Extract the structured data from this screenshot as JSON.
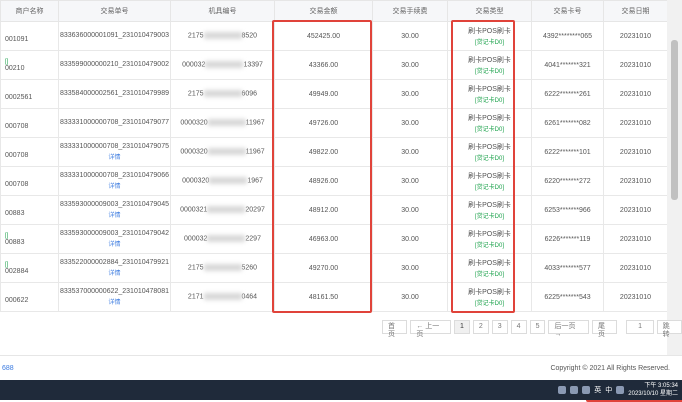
{
  "table": {
    "headers": [
      "商户名称",
      "交易单号",
      "机具编号",
      "交易金额",
      "交易手续费",
      "交易类型",
      "交易卡号",
      "交易日期"
    ],
    "rows": [
      {
        "merchant": "",
        "merchant_code": "001091",
        "order": "833636000001091_231010479003",
        "order_sub": "",
        "device": "2175",
        "device_tail": "8520",
        "amount": "452425.00",
        "fee": "30.00",
        "type": "刷卡POS刷卡",
        "type_sub": "[贷记卡D0]",
        "card": "4392********065",
        "date": "20231010"
      },
      {
        "merchant": "[]",
        "merchant_code": "00210",
        "order": "833599000000210_231010479002",
        "order_sub": "",
        "device": "000032",
        "device_tail": "13397",
        "amount": "43366.00",
        "fee": "30.00",
        "type": "刷卡POS刷卡",
        "type_sub": "[贷记卡D0]",
        "card": "4041*******321",
        "date": "20231010"
      },
      {
        "merchant": "",
        "merchant_code": "0002561",
        "order": "833584000002561_231010479989",
        "order_sub": "",
        "device": "2175",
        "device_tail": "6096",
        "amount": "49949.00",
        "fee": "30.00",
        "type": "刷卡POS刷卡",
        "type_sub": "[贷记卡D0]",
        "card": "6222*******261",
        "date": "20231010"
      },
      {
        "merchant": "",
        "merchant_code": "000708",
        "order": "833331000000708_231010479077",
        "order_sub": "",
        "device": "0000320",
        "device_tail": "11967",
        "amount": "49726.00",
        "fee": "30.00",
        "type": "刷卡POS刷卡",
        "type_sub": "[贷记卡D0]",
        "card": "6261*******082",
        "date": "20231010"
      },
      {
        "merchant": "",
        "merchant_code": "000708",
        "order": "833331000000708_231010479075",
        "order_sub": "详情",
        "device": "0000320",
        "device_tail": "11967",
        "amount": "49822.00",
        "fee": "30.00",
        "type": "刷卡POS刷卡",
        "type_sub": "[贷记卡D0]",
        "card": "6222*******101",
        "date": "20231010"
      },
      {
        "merchant": "",
        "merchant_code": "000708",
        "order": "833331000000708_231010479066",
        "order_sub": "详情",
        "device": "0000320",
        "device_tail": "1967",
        "amount": "48926.00",
        "fee": "30.00",
        "type": "刷卡POS刷卡",
        "type_sub": "[贷记卡D0]",
        "card": "6220*******272",
        "date": "20231010"
      },
      {
        "merchant": "",
        "merchant_code": "00883",
        "order": "833593000009003_231010479045",
        "order_sub": "详情",
        "device": "0000321",
        "device_tail": "20297",
        "amount": "48912.00",
        "fee": "30.00",
        "type": "刷卡POS刷卡",
        "type_sub": "[贷记卡D0]",
        "card": "6253*******966",
        "date": "20231010"
      },
      {
        "merchant": "[]",
        "merchant_code": "00883",
        "order": "833593000009003_231010479042",
        "order_sub": "详情",
        "device": "000032",
        "device_tail": "2297",
        "amount": "46963.00",
        "fee": "30.00",
        "type": "刷卡POS刷卡",
        "type_sub": "[贷记卡D0]",
        "card": "6226*******119",
        "date": "20231010"
      },
      {
        "merchant": "[]",
        "merchant_code": "002884",
        "order": "833522000002884_231010479921",
        "order_sub": "详情",
        "device": "2175",
        "device_tail": "5260",
        "amount": "49270.00",
        "fee": "30.00",
        "type": "刷卡POS刷卡",
        "type_sub": "[贷记卡D0]",
        "card": "4033*******577",
        "date": "20231010"
      },
      {
        "merchant": "",
        "merchant_code": "000622",
        "order": "833537000000622_231010478081",
        "order_sub": "详情",
        "device": "2171",
        "device_tail": "0464",
        "amount": "48161.50",
        "fee": "30.00",
        "type": "刷卡POS刷卡",
        "type_sub": "[贷记卡D0]",
        "card": "6225*******543",
        "date": "20231010"
      }
    ]
  },
  "pager": {
    "first": "首页",
    "prev": "← 上一页",
    "pages": [
      "1",
      "2",
      "3",
      "4",
      "5"
    ],
    "active": "1",
    "next": "后一页 →",
    "last": "尾页",
    "goto_value": "1",
    "goto_button": "跳转"
  },
  "footer": {
    "left": "688",
    "right": "Copyright © 2021 All Rights Reserved."
  },
  "taskbar": {
    "ime1": "英",
    "ime2": "中",
    "time": "下午 3:05:34",
    "date": "2023/10/10 星期二"
  },
  "colors": {
    "highlight": "#e0433a",
    "link": "#3a7ae0",
    "tag_green": "#1aa14a"
  }
}
